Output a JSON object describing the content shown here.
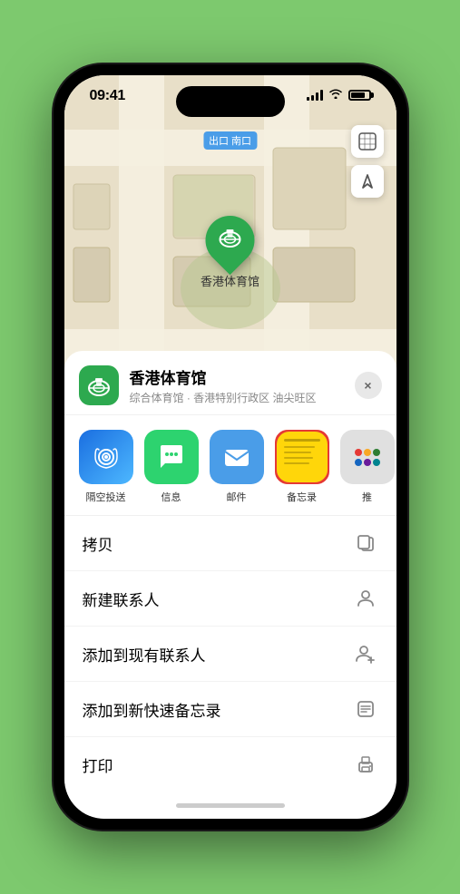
{
  "status_bar": {
    "time": "09:41",
    "location_arrow": "▲"
  },
  "map": {
    "label": "南口",
    "label_prefix": "出口"
  },
  "venue": {
    "name": "香港体育馆",
    "subtitle": "综合体育馆 · 香港特别行政区 油尖旺区",
    "emoji": "🏟️"
  },
  "share_items": [
    {
      "id": "airdrop",
      "label": "隔空投送"
    },
    {
      "id": "message",
      "label": "信息"
    },
    {
      "id": "mail",
      "label": "邮件"
    },
    {
      "id": "notes",
      "label": "备忘录"
    },
    {
      "id": "more",
      "label": "推"
    }
  ],
  "menu_items": [
    {
      "id": "copy",
      "label": "拷贝",
      "icon": "copy"
    },
    {
      "id": "new-contact",
      "label": "新建联系人",
      "icon": "person"
    },
    {
      "id": "add-contact",
      "label": "添加到现有联系人",
      "icon": "person-add"
    },
    {
      "id": "quick-note",
      "label": "添加到新快速备忘录",
      "icon": "note"
    },
    {
      "id": "print",
      "label": "打印",
      "icon": "print"
    }
  ],
  "close_label": "×",
  "map_control_icons": {
    "map_type": "🗺",
    "location": "↗"
  }
}
